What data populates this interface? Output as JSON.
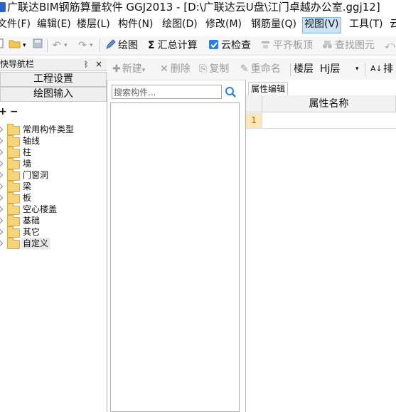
{
  "window": {
    "title": "广联达BIM钢筋算量软件 GGJ2013 - [D:\\广联达云U盘\\江门卓越办公室.ggj12]"
  },
  "menu": {
    "items": [
      {
        "label": "文件(F)"
      },
      {
        "label": "编辑(E)"
      },
      {
        "label": "楼层(L)"
      },
      {
        "label": "构件(N)"
      },
      {
        "label": "绘图(D)"
      },
      {
        "label": "修改(M)"
      },
      {
        "label": "钢筋量(Q)"
      },
      {
        "label": "视图(V)"
      },
      {
        "label": "工具(T)"
      },
      {
        "label": "云"
      }
    ],
    "active": "视图(V)"
  },
  "toolbar": {
    "draw": "绘图",
    "calc": "汇总计算",
    "cloud_check": "云检查",
    "align_top": "平齐板顶",
    "find_element": "查找图元"
  },
  "nav": {
    "header": "快导航栏",
    "pin": "ᛒ",
    "close": "×",
    "project_settings": "工程设置",
    "drawing_input": "绘图输入",
    "expand_all": "+",
    "collapse_all": "−",
    "tree": [
      {
        "label": "常用构件类型"
      },
      {
        "label": "轴线"
      },
      {
        "label": "柱"
      },
      {
        "label": "墙"
      },
      {
        "label": "门窗洞"
      },
      {
        "label": "梁"
      },
      {
        "label": "板"
      },
      {
        "label": "空心楼盖"
      },
      {
        "label": "基础"
      },
      {
        "label": "其它"
      },
      {
        "label": "自定义",
        "selected": true
      }
    ]
  },
  "component_toolbar": {
    "new": "新建",
    "delete": "删除",
    "copy": "复制",
    "rename": "重命名",
    "floor_label": "楼层",
    "floor_value": "Hj层",
    "sort": "排"
  },
  "search": {
    "placeholder": "搜索构件..."
  },
  "properties": {
    "tab": "属性编辑",
    "header_name": "属性名称",
    "rows": [
      {
        "index": "1"
      }
    ]
  },
  "colors": {
    "accent": "#cde4f7",
    "folder": "#f6d47a"
  }
}
